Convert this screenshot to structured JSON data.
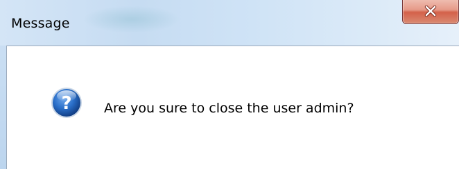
{
  "dialog": {
    "title": "Message",
    "message": "Are you sure to close the user admin?",
    "icon": "question-icon",
    "close_icon": "close-icon"
  },
  "colors": {
    "title_bar": "#c6dcf2",
    "close_button": "#d4614a",
    "question_icon": "#1f5fb5",
    "content_background": "#ffffff"
  }
}
